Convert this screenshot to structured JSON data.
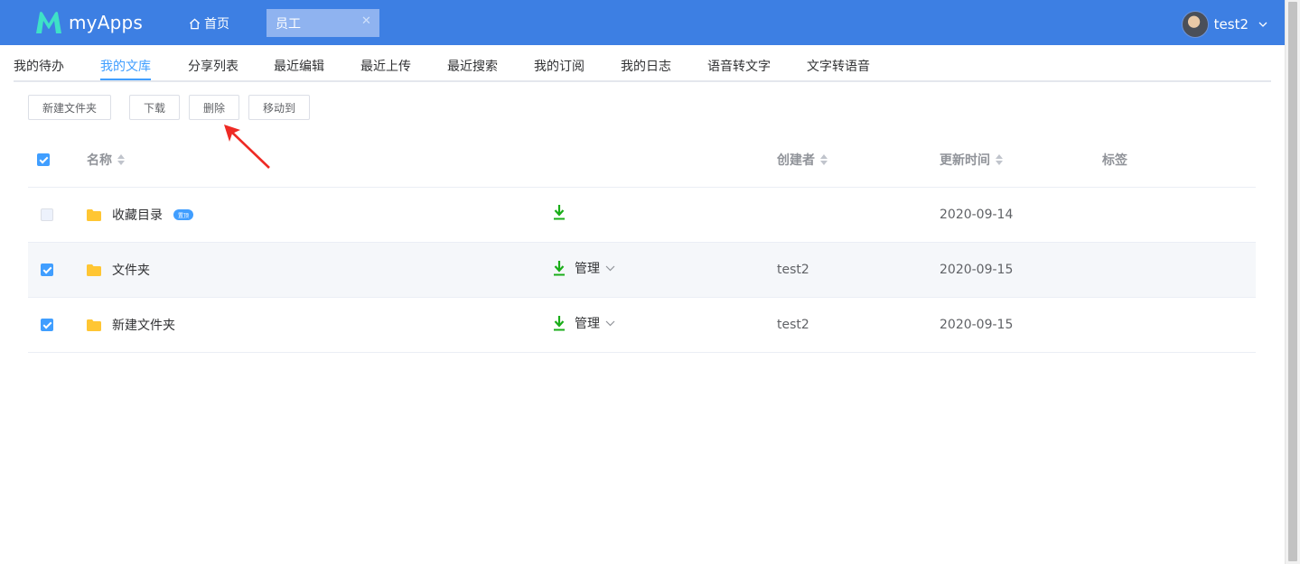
{
  "app": {
    "name": "myApps"
  },
  "colors": {
    "topbar": "#3d7fe3",
    "accent": "#409eff",
    "download": "#1aad19",
    "folder": "#ffc633"
  },
  "topbar": {
    "home_label": "首页",
    "open_tab_label": "员工",
    "user_name": "test2"
  },
  "subnav": {
    "items": [
      {
        "label": "我的待办"
      },
      {
        "label": "我的文库",
        "active": true
      },
      {
        "label": "分享列表"
      },
      {
        "label": "最近编辑"
      },
      {
        "label": "最近上传"
      },
      {
        "label": "最近搜索"
      },
      {
        "label": "我的订阅"
      },
      {
        "label": "我的日志"
      },
      {
        "label": "语音转文字"
      },
      {
        "label": "文字转语音"
      }
    ]
  },
  "toolbar": {
    "new_folder": "新建文件夹",
    "download": "下载",
    "delete": "删除",
    "move_to": "移动到"
  },
  "table": {
    "columns": {
      "name": "名称",
      "creator": "创建者",
      "updated": "更新时间",
      "tags": "标签"
    },
    "header_checked": true,
    "rows": [
      {
        "name": "收藏目录",
        "badge": "置顶",
        "creator": "",
        "updated": "2020-09-14",
        "checked": false,
        "disabled": true,
        "manage": ""
      },
      {
        "name": "文件夹",
        "badge": "",
        "creator": "test2",
        "updated": "2020-09-15",
        "checked": true,
        "disabled": false,
        "manage": "管理"
      },
      {
        "name": "新建文件夹",
        "badge": "",
        "creator": "test2",
        "updated": "2020-09-15",
        "checked": true,
        "disabled": false,
        "manage": "管理"
      }
    ]
  },
  "icons": {
    "logo": "myapps-m-logo",
    "home": "home-icon",
    "close": "close-icon",
    "caret": "chevron-down-icon",
    "folder": "folder-icon",
    "download": "download-icon",
    "sort": "sort-icon",
    "annotation": "red-arrow-annotation"
  }
}
